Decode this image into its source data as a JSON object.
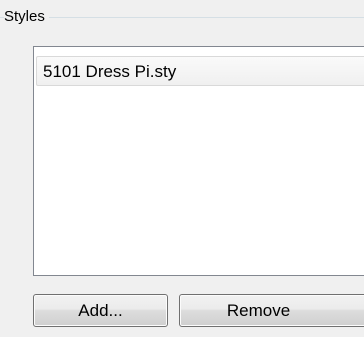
{
  "group": {
    "title": "Styles"
  },
  "styles_list": {
    "items": [
      {
        "label": "5101 Dress Pi.sty"
      }
    ]
  },
  "buttons": {
    "add_label": "Add...",
    "remove_label": "Remove"
  }
}
